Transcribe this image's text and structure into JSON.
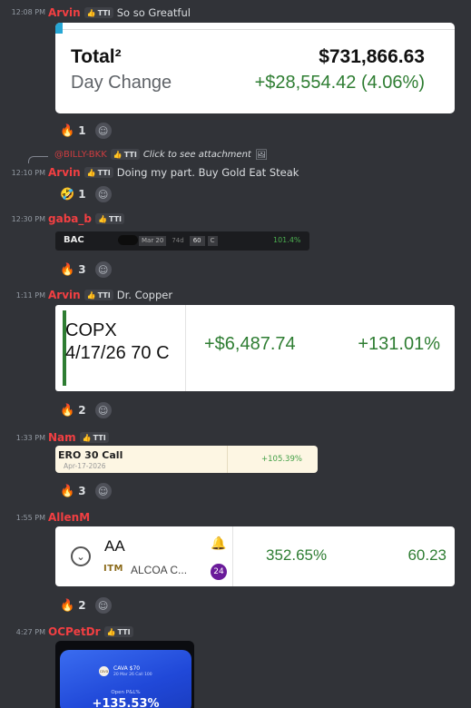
{
  "tag_label": "TTI",
  "messages": [
    {
      "time": "12:08 PM",
      "user": "Arvin",
      "text": "So so Greatful"
    },
    {
      "time": "12:10 PM",
      "user": "Arvin",
      "text": "Doing my part. Buy Gold Eat Steak",
      "reply": {
        "user": "@BILLY-BKK",
        "text": "Click to see attachment"
      }
    },
    {
      "time": "12:30 PM",
      "user": "gaba_b",
      "text": ""
    },
    {
      "time": "1:11 PM",
      "user": "Arvin",
      "text": "Dr. Copper"
    },
    {
      "time": "1:33 PM",
      "user": "Nam",
      "text": ""
    },
    {
      "time": "1:55 PM",
      "user": "AllenM",
      "text": ""
    },
    {
      "time": "4:27 PM",
      "user": "OCPetDr",
      "text": ""
    }
  ],
  "reactions": [
    {
      "emoji": "🔥",
      "count": "1"
    },
    {
      "emoji": "🤣",
      "count": "1"
    },
    {
      "emoji": "🔥",
      "count": "3"
    },
    {
      "emoji": "🔥",
      "count": "2"
    },
    {
      "emoji": "🔥",
      "count": "3"
    },
    {
      "emoji": "🔥",
      "count": "2"
    }
  ],
  "total_card": {
    "total_label": "Total²",
    "total_value": "$731,866.63",
    "day_label": "Day Change",
    "day_value": "+$28,554.42 (4.06%)"
  },
  "bac_card": {
    "symbol": "BAC",
    "date": "Mar 20",
    "days": "74d",
    "strike": "60",
    "type": "C",
    "pct": "101.4%"
  },
  "copx_card": {
    "name_line1": "COPX",
    "name_line2": "4/17/26 70 C",
    "gain": "+$6,487.74",
    "pct": "+131.01%"
  },
  "ero_card": {
    "title": "ERO 30 Call",
    "date": "Apr-17-2026",
    "pct": "+105.39%"
  },
  "aa_card": {
    "symbol": "AA",
    "itm": "ITM",
    "company": "ALCOA C...",
    "badge": "24",
    "pct": "352.65%",
    "price": "60.23"
  },
  "cava_card": {
    "title": "CAVA $70",
    "sub": "20 Mar 26 Call 100",
    "pl_label": "Open P&L%",
    "pl_value": "+135.53%"
  },
  "colors": {
    "arvin": "#f23f42",
    "nam": "#f23f42",
    "green": "#2e7d32",
    "ero_green": "#43a047"
  }
}
